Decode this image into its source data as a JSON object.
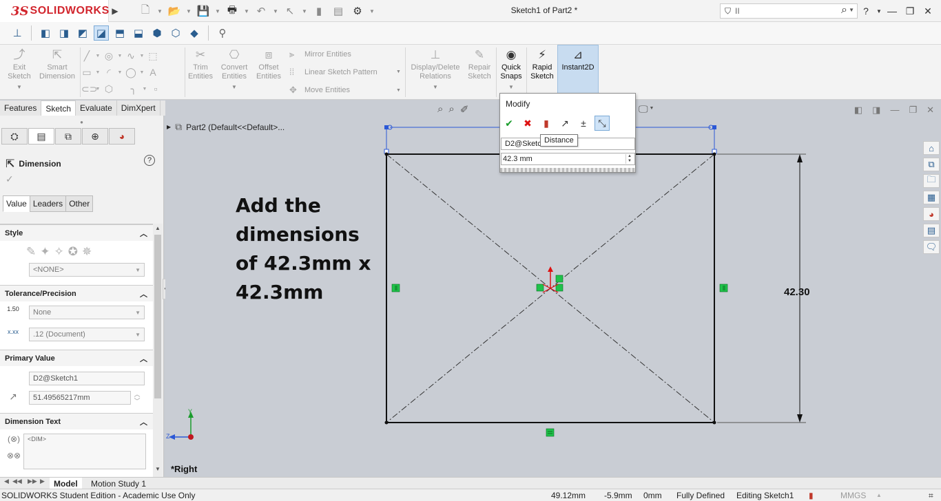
{
  "app": {
    "brand_prefix": "3S",
    "brand_name": "SOLIDWORKS",
    "document_title": "Sketch1 of Part2 *",
    "search_placeholder": "II"
  },
  "command_manager": {
    "exit_sketch": "Exit Sketch",
    "smart_dimension": "Smart Dimension",
    "trim_entities": "Trim Entities",
    "convert_entities": "Convert Entities",
    "offset_entities": "Offset Entities",
    "mirror_entities": "Mirror Entities",
    "linear_sketch_pattern": "Linear Sketch Pattern",
    "move_entities": "Move Entities",
    "display_delete_relations": "Display/Delete Relations",
    "repair_sketch": "Repair Sketch",
    "quick_snaps": "Quick Snaps",
    "rapid_sketch": "Rapid Sketch",
    "instant2d": "Instant2D"
  },
  "tabs": [
    "Features",
    "Sketch",
    "Evaluate",
    "DimXpert"
  ],
  "property_manager": {
    "title": "Dimension",
    "value_tabs": [
      "Value",
      "Leaders",
      "Other"
    ],
    "style": {
      "header": "Style",
      "favorite": "<NONE>"
    },
    "tolerance": {
      "header": "Tolerance/Precision",
      "tolerance_icon": "1.50",
      "tolerance_type": "None",
      "precision": ".12 (Document)"
    },
    "primary_value": {
      "header": "Primary Value",
      "name": "D2@Sketch1",
      "value": "51.49565217mm"
    },
    "dimension_text": {
      "header": "Dimension Text",
      "text": "<DIM>"
    }
  },
  "graphics": {
    "tree_root": "Part2  (Default<<Default>...",
    "instruction": "Add the dimensions of 42.3mm x 42.3mm",
    "dimension_value": "42.30",
    "view_label": "*Right",
    "axis_y": "Y",
    "axis_z": "Z"
  },
  "modify_dialog": {
    "title": "Modify",
    "name": "D2@Sketc",
    "value": "42.3 mm",
    "tooltip": "Distance"
  },
  "bottom_tabs": [
    "Model",
    "Motion Study 1"
  ],
  "status_bar": {
    "edition": "SOLIDWORKS Student Edition - Academic Use Only",
    "x": "49.12mm",
    "y": "-5.9mm",
    "z": "0mm",
    "state": "Fully Defined",
    "editing": "Editing Sketch1",
    "units": "MMGS"
  },
  "colors": {
    "brand": "#d2262e",
    "relation_marker": "#1fc24a",
    "selection_blue": "#2b58d6"
  }
}
